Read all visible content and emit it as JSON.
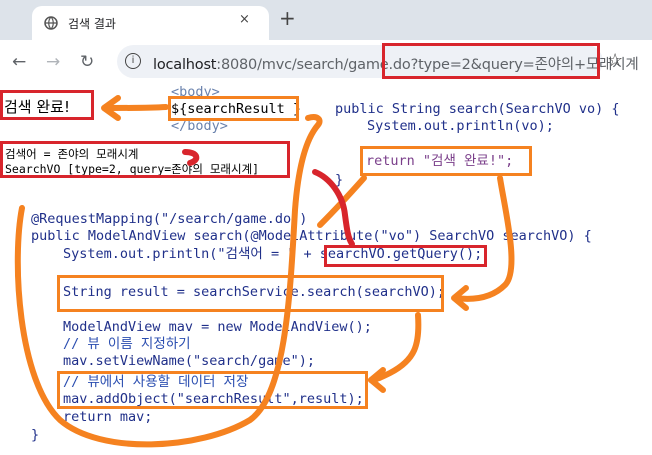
{
  "browser": {
    "tab_title": "검색 결과",
    "tab_close": "×",
    "new_tab": "+",
    "back": "←",
    "forward": "→",
    "reload": "↻",
    "url_host": "localhost",
    "url_path": ":8080/mvc/search/game.do?type=2&query=존야의+모래시계",
    "info": "i",
    "star": "☆"
  },
  "page": {
    "result_text": "검색 완료!",
    "console_line1": "검색어 = 존야의 모래시계",
    "console_line2": "SearchVO [type=2, query=존야의 모래시계]"
  },
  "jsp": {
    "body_open": "<body>",
    "search_result": "${searchResult }",
    "body_close": "</body>"
  },
  "service": {
    "line1": "public String search(SearchVO vo) {",
    "line2": "System.out.println(vo);",
    "line3": "return \"검색 완료!\";",
    "line4": "}"
  },
  "controller": {
    "annotation": "@RequestMapping(\"/search/game.do\")",
    "signature": "public ModelAndView search(@ModelAttribute(\"vo\") SearchVO searchVO) {",
    "println_prefix": "System.out.println(\"검색어 = \" + ",
    "println_call": "searchVO.getQuery()",
    "println_suffix": ";",
    "result_line": "String result = searchService.search(searchVO);",
    "mav_line": "ModelAndView mav = new ModelAndView();",
    "comment_view": "// 뷰 이름 지정하기",
    "set_view": "mav.setViewName(\"search/game\");",
    "comment_data": "// 뷰에서 사용할 데이터 저장",
    "add_object": "mav.addObject(\"searchResult\",result);",
    "return_line": "return mav;",
    "close_brace": "}"
  },
  "colors": {
    "orange": "#f58220",
    "red": "#d8252c"
  }
}
